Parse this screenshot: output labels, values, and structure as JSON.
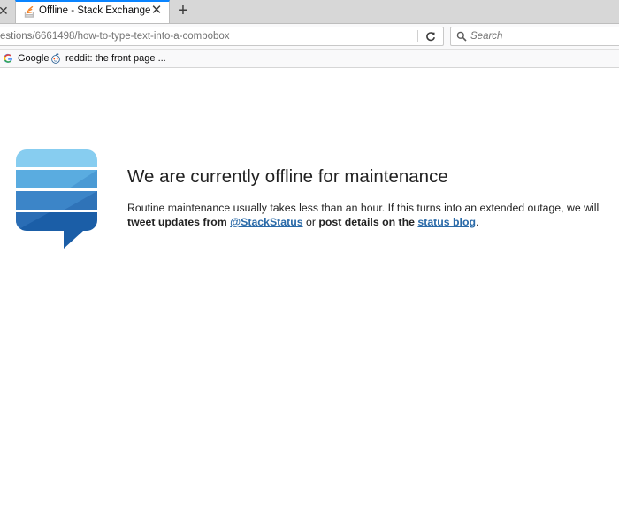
{
  "browser": {
    "tab": {
      "title": "Offline - Stack Exchange"
    },
    "new_tab_label": "+",
    "address": "estions/6661498/how-to-type-text-into-a-combobox",
    "search_placeholder": "Search",
    "bookmarks": [
      {
        "label": "Google",
        "icon": "google-icon"
      },
      {
        "label": "reddit: the front page ...",
        "icon": "reddit-icon"
      }
    ]
  },
  "page": {
    "heading": "We are currently offline for maintenance",
    "message": {
      "part1": "Routine maintenance usually takes less than an hour. If this turns into an extended outage, we will ",
      "bold1": "tweet updates from",
      "space1": " ",
      "link1": "@StackStatus",
      "part2": " or ",
      "bold2": "post details on the",
      "space2": " ",
      "link2": "status blog",
      "part3": "."
    },
    "logo_colors": [
      "#87cdf0",
      "#5aace0",
      "#3c85c8",
      "#1b5ea7"
    ]
  }
}
